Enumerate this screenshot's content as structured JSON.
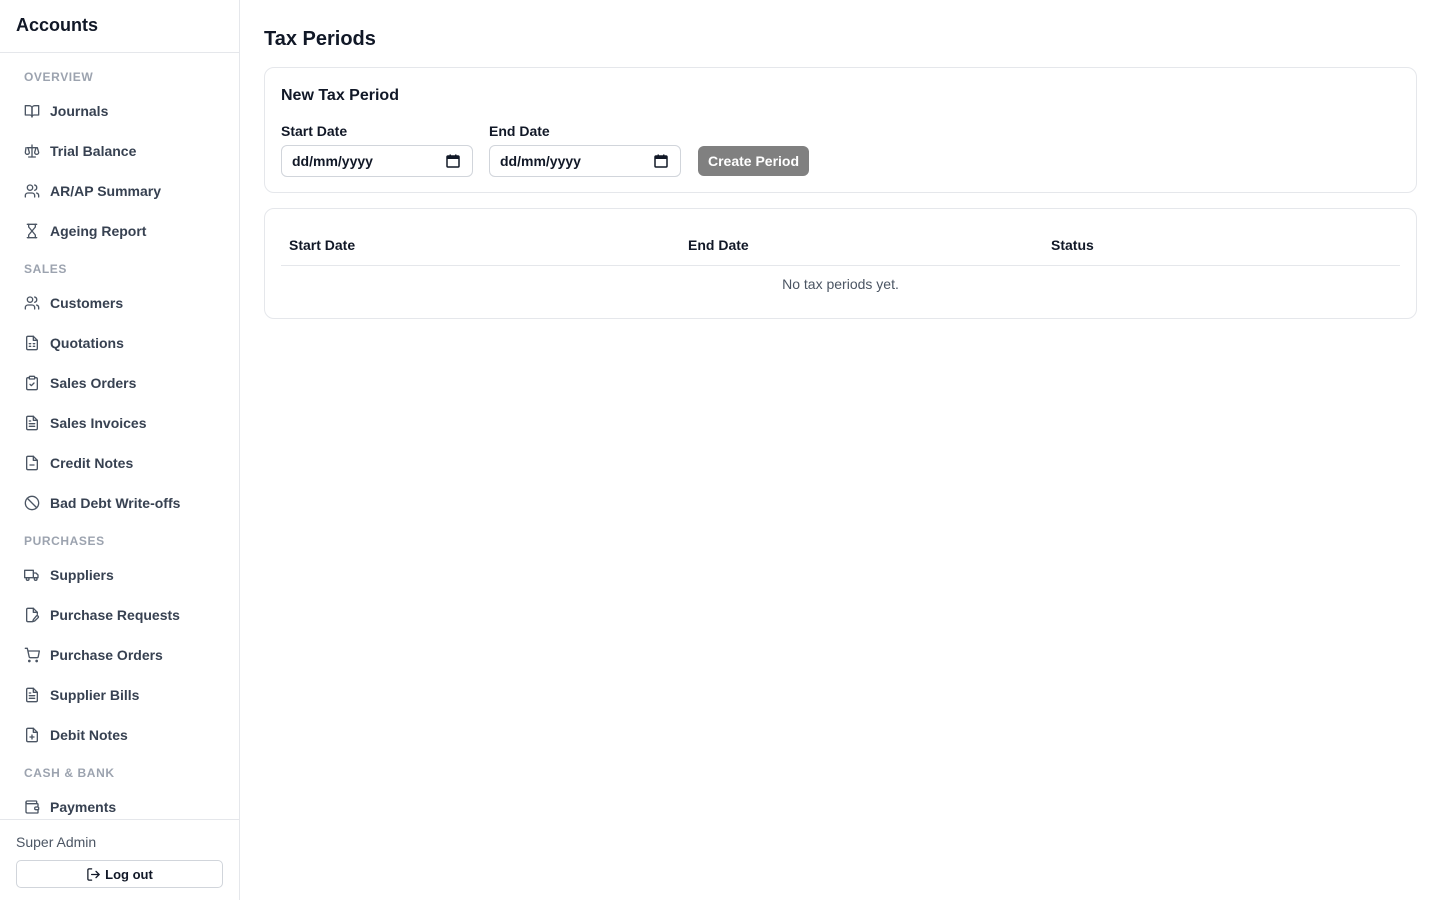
{
  "app": {
    "title": "Accounts"
  },
  "sidebar": {
    "sections": [
      {
        "label": "OVERVIEW",
        "items": [
          {
            "label": "Journals",
            "icon": "book-open-icon"
          },
          {
            "label": "Trial Balance",
            "icon": "scale-icon"
          },
          {
            "label": "AR/AP Summary",
            "icon": "users-icon"
          },
          {
            "label": "Ageing Report",
            "icon": "hourglass-icon"
          }
        ]
      },
      {
        "label": "SALES",
        "items": [
          {
            "label": "Customers",
            "icon": "users-icon"
          },
          {
            "label": "Quotations",
            "icon": "file-spreadsheet-icon"
          },
          {
            "label": "Sales Orders",
            "icon": "clipboard-check-icon"
          },
          {
            "label": "Sales Invoices",
            "icon": "file-text-icon"
          },
          {
            "label": "Credit Notes",
            "icon": "file-minus-icon"
          },
          {
            "label": "Bad Debt Write-offs",
            "icon": "ban-icon"
          }
        ]
      },
      {
        "label": "PURCHASES",
        "items": [
          {
            "label": "Suppliers",
            "icon": "truck-icon"
          },
          {
            "label": "Purchase Requests",
            "icon": "file-pen-icon"
          },
          {
            "label": "Purchase Orders",
            "icon": "shopping-cart-icon"
          },
          {
            "label": "Supplier Bills",
            "icon": "file-text-icon"
          },
          {
            "label": "Debit Notes",
            "icon": "file-plus-icon"
          }
        ]
      },
      {
        "label": "CASH & BANK",
        "items": [
          {
            "label": "Payments",
            "icon": "wallet-icon"
          }
        ]
      }
    ],
    "footer": {
      "user": "Super Admin",
      "logout_label": "Log out"
    }
  },
  "main": {
    "title": "Tax Periods",
    "form": {
      "title": "New Tax Period",
      "start_label": "Start Date",
      "start_value": "dd/mm/yyyy",
      "end_label": "End Date",
      "end_value": "dd/mm/yyyy",
      "submit_label": "Create Period",
      "submit_color": "#808080"
    },
    "table": {
      "columns": [
        "Start Date",
        "End Date",
        "Status"
      ],
      "empty_text": "No tax periods yet."
    }
  }
}
